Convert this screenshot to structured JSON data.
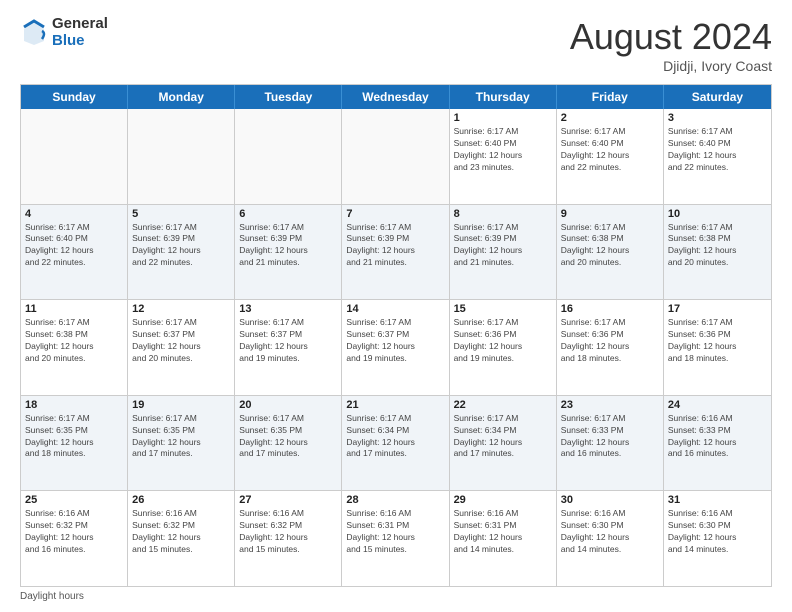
{
  "header": {
    "logo_general": "General",
    "logo_blue": "Blue",
    "month_year": "August 2024",
    "location": "Djidji, Ivory Coast"
  },
  "weekdays": [
    "Sunday",
    "Monday",
    "Tuesday",
    "Wednesday",
    "Thursday",
    "Friday",
    "Saturday"
  ],
  "footer": {
    "daylight_label": "Daylight hours"
  },
  "rows": [
    {
      "alt": false,
      "cells": [
        {
          "empty": true,
          "day": "",
          "info": ""
        },
        {
          "empty": true,
          "day": "",
          "info": ""
        },
        {
          "empty": true,
          "day": "",
          "info": ""
        },
        {
          "empty": true,
          "day": "",
          "info": ""
        },
        {
          "empty": false,
          "day": "1",
          "info": "Sunrise: 6:17 AM\nSunset: 6:40 PM\nDaylight: 12 hours\nand 23 minutes."
        },
        {
          "empty": false,
          "day": "2",
          "info": "Sunrise: 6:17 AM\nSunset: 6:40 PM\nDaylight: 12 hours\nand 22 minutes."
        },
        {
          "empty": false,
          "day": "3",
          "info": "Sunrise: 6:17 AM\nSunset: 6:40 PM\nDaylight: 12 hours\nand 22 minutes."
        }
      ]
    },
    {
      "alt": true,
      "cells": [
        {
          "empty": false,
          "day": "4",
          "info": "Sunrise: 6:17 AM\nSunset: 6:40 PM\nDaylight: 12 hours\nand 22 minutes."
        },
        {
          "empty": false,
          "day": "5",
          "info": "Sunrise: 6:17 AM\nSunset: 6:39 PM\nDaylight: 12 hours\nand 22 minutes."
        },
        {
          "empty": false,
          "day": "6",
          "info": "Sunrise: 6:17 AM\nSunset: 6:39 PM\nDaylight: 12 hours\nand 21 minutes."
        },
        {
          "empty": false,
          "day": "7",
          "info": "Sunrise: 6:17 AM\nSunset: 6:39 PM\nDaylight: 12 hours\nand 21 minutes."
        },
        {
          "empty": false,
          "day": "8",
          "info": "Sunrise: 6:17 AM\nSunset: 6:39 PM\nDaylight: 12 hours\nand 21 minutes."
        },
        {
          "empty": false,
          "day": "9",
          "info": "Sunrise: 6:17 AM\nSunset: 6:38 PM\nDaylight: 12 hours\nand 20 minutes."
        },
        {
          "empty": false,
          "day": "10",
          "info": "Sunrise: 6:17 AM\nSunset: 6:38 PM\nDaylight: 12 hours\nand 20 minutes."
        }
      ]
    },
    {
      "alt": false,
      "cells": [
        {
          "empty": false,
          "day": "11",
          "info": "Sunrise: 6:17 AM\nSunset: 6:38 PM\nDaylight: 12 hours\nand 20 minutes."
        },
        {
          "empty": false,
          "day": "12",
          "info": "Sunrise: 6:17 AM\nSunset: 6:37 PM\nDaylight: 12 hours\nand 20 minutes."
        },
        {
          "empty": false,
          "day": "13",
          "info": "Sunrise: 6:17 AM\nSunset: 6:37 PM\nDaylight: 12 hours\nand 19 minutes."
        },
        {
          "empty": false,
          "day": "14",
          "info": "Sunrise: 6:17 AM\nSunset: 6:37 PM\nDaylight: 12 hours\nand 19 minutes."
        },
        {
          "empty": false,
          "day": "15",
          "info": "Sunrise: 6:17 AM\nSunset: 6:36 PM\nDaylight: 12 hours\nand 19 minutes."
        },
        {
          "empty": false,
          "day": "16",
          "info": "Sunrise: 6:17 AM\nSunset: 6:36 PM\nDaylight: 12 hours\nand 18 minutes."
        },
        {
          "empty": false,
          "day": "17",
          "info": "Sunrise: 6:17 AM\nSunset: 6:36 PM\nDaylight: 12 hours\nand 18 minutes."
        }
      ]
    },
    {
      "alt": true,
      "cells": [
        {
          "empty": false,
          "day": "18",
          "info": "Sunrise: 6:17 AM\nSunset: 6:35 PM\nDaylight: 12 hours\nand 18 minutes."
        },
        {
          "empty": false,
          "day": "19",
          "info": "Sunrise: 6:17 AM\nSunset: 6:35 PM\nDaylight: 12 hours\nand 17 minutes."
        },
        {
          "empty": false,
          "day": "20",
          "info": "Sunrise: 6:17 AM\nSunset: 6:35 PM\nDaylight: 12 hours\nand 17 minutes."
        },
        {
          "empty": false,
          "day": "21",
          "info": "Sunrise: 6:17 AM\nSunset: 6:34 PM\nDaylight: 12 hours\nand 17 minutes."
        },
        {
          "empty": false,
          "day": "22",
          "info": "Sunrise: 6:17 AM\nSunset: 6:34 PM\nDaylight: 12 hours\nand 17 minutes."
        },
        {
          "empty": false,
          "day": "23",
          "info": "Sunrise: 6:17 AM\nSunset: 6:33 PM\nDaylight: 12 hours\nand 16 minutes."
        },
        {
          "empty": false,
          "day": "24",
          "info": "Sunrise: 6:16 AM\nSunset: 6:33 PM\nDaylight: 12 hours\nand 16 minutes."
        }
      ]
    },
    {
      "alt": false,
      "cells": [
        {
          "empty": false,
          "day": "25",
          "info": "Sunrise: 6:16 AM\nSunset: 6:32 PM\nDaylight: 12 hours\nand 16 minutes."
        },
        {
          "empty": false,
          "day": "26",
          "info": "Sunrise: 6:16 AM\nSunset: 6:32 PM\nDaylight: 12 hours\nand 15 minutes."
        },
        {
          "empty": false,
          "day": "27",
          "info": "Sunrise: 6:16 AM\nSunset: 6:32 PM\nDaylight: 12 hours\nand 15 minutes."
        },
        {
          "empty": false,
          "day": "28",
          "info": "Sunrise: 6:16 AM\nSunset: 6:31 PM\nDaylight: 12 hours\nand 15 minutes."
        },
        {
          "empty": false,
          "day": "29",
          "info": "Sunrise: 6:16 AM\nSunset: 6:31 PM\nDaylight: 12 hours\nand 14 minutes."
        },
        {
          "empty": false,
          "day": "30",
          "info": "Sunrise: 6:16 AM\nSunset: 6:30 PM\nDaylight: 12 hours\nand 14 minutes."
        },
        {
          "empty": false,
          "day": "31",
          "info": "Sunrise: 6:16 AM\nSunset: 6:30 PM\nDaylight: 12 hours\nand 14 minutes."
        }
      ]
    }
  ]
}
